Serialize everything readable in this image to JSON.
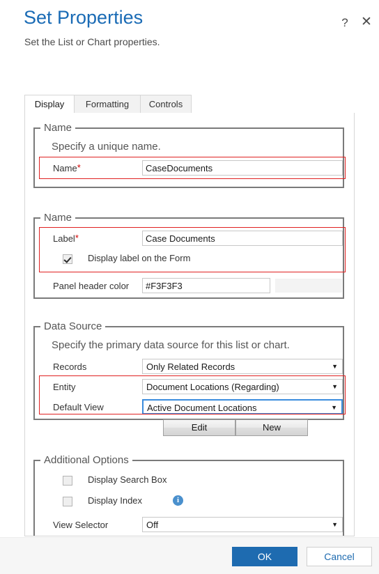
{
  "header": {
    "title": "Set Properties",
    "subtitle": "Set the List or Chart properties.",
    "help_icon": "question-mark-icon",
    "close_icon": "close-x-icon",
    "accent_color": "#1a6bb5"
  },
  "tabs": [
    {
      "label": "Display",
      "active": true
    },
    {
      "label": "Formatting",
      "active": false
    },
    {
      "label": "Controls",
      "active": false
    }
  ],
  "sections": {
    "name_unique": {
      "legend": "Name",
      "description": "Specify a unique name.",
      "name_label": "Name",
      "name_required": "*",
      "name_value": "CaseDocuments"
    },
    "name_label_group": {
      "legend": "Name",
      "label_label": "Label",
      "label_required": "*",
      "label_value": "Case Documents",
      "display_label_checkbox": {
        "label": "Display label on the Form",
        "checked": true
      },
      "panel_header_color_label": "Panel header color",
      "panel_header_color_value": "#F3F3F3"
    },
    "data_source": {
      "legend": "Data Source",
      "description": "Specify the primary data source for this list or chart.",
      "records_label": "Records",
      "records_value": "Only Related Records",
      "entity_label": "Entity",
      "entity_value": "Document Locations (Regarding)",
      "default_view_label": "Default View",
      "default_view_value": "Active Document Locations",
      "edit_button": "Edit",
      "new_button": "New"
    },
    "additional_options": {
      "legend": "Additional Options",
      "display_search_box": {
        "label": "Display Search Box",
        "checked": false
      },
      "display_index": {
        "label": "Display Index",
        "checked": false,
        "info_icon": "info-icon",
        "info_glyph": "i"
      },
      "view_selector_label": "View Selector",
      "view_selector_value": "Off"
    }
  },
  "footer": {
    "ok_label": "OK",
    "cancel_label": "Cancel",
    "primary_color": "#1e6bb0"
  },
  "glyphs": {
    "help": "?",
    "close": "✕",
    "caret_down": "▼"
  }
}
